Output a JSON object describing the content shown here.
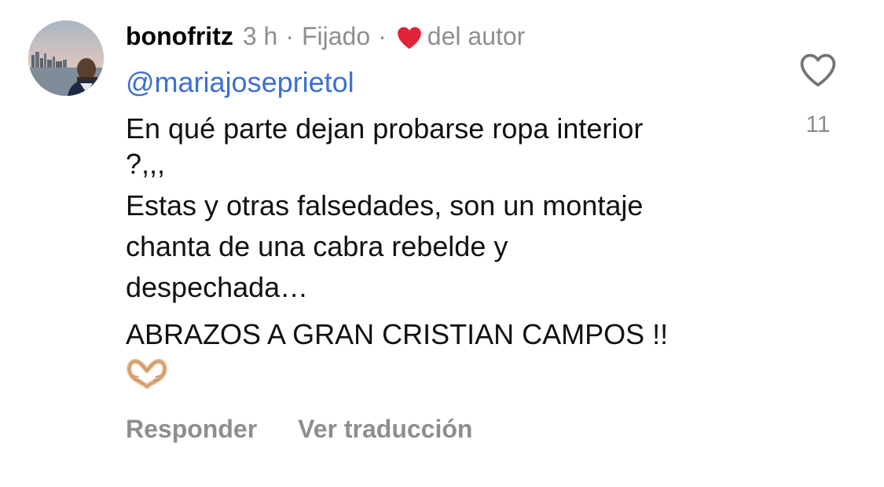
{
  "comment": {
    "username": "bonofritz",
    "time": "3 h",
    "separator": "·",
    "pinned_label": "Fijado",
    "author_liked_label": "del autor",
    "mention": "@mariajoseprietol",
    "body_lines": [
      "En qué parte dejan probarse ropa interior",
      "?,,,",
      "Estas y otras falsedades, son un montaje",
      "chanta de una cabra rebelde y",
      "despechada…",
      "ABRAZOS A GRAN CRISTIAN CAMPOS !!"
    ],
    "emoji": "heart-hands-emoji",
    "like_count": "11"
  },
  "actions": {
    "reply_label": "Responder",
    "translate_label": "Ver traducción"
  },
  "icons": {
    "author_heart": "heart-filled-icon",
    "like": "heart-outline-icon"
  },
  "colors": {
    "mention": "#3b6fd4",
    "author_heart": "#e0243a",
    "secondary_text": "#8e8e8e"
  }
}
